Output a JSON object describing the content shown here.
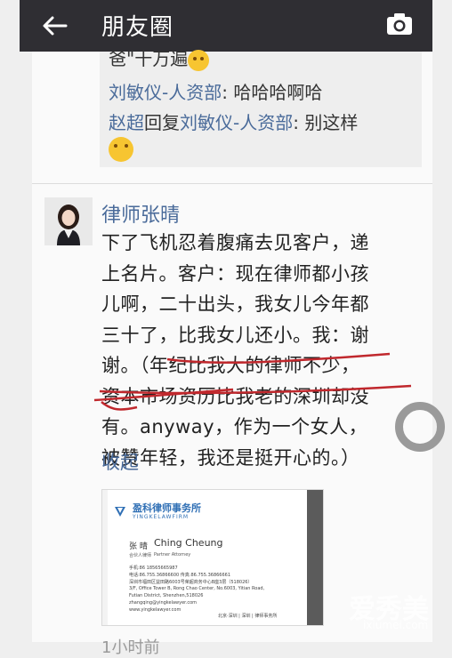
{
  "navbar": {
    "title": "朋友圈"
  },
  "comments": [
    {
      "name": "",
      "text": "爸\"十万遍"
    },
    {
      "name": "刘敏仪-人资部",
      "text": ": 哈哈哈啊哈"
    },
    {
      "name": "赵超",
      "reply_word": "回复",
      "reply_to": "刘敏仪-人资部",
      "text": ": 别这样"
    }
  ],
  "post": {
    "author": "律师张晴",
    "lines": [
      "下了飞机忍着腹痛去见客户，递",
      "上名片。客户：现在律师都小孩",
      "儿啊，二十出头，我女儿今年都",
      "三十了，比我女儿还小。我：谢",
      "谢。（年纪比我大的律师不少，",
      "资本市场资历比我老的深圳却没",
      "有。anyway，作为一个女人，",
      "被赞年轻，我还是挺开心的。）"
    ],
    "collapse": "收起",
    "time": "1小时前"
  },
  "card": {
    "firm_name": "盈科律师事务所",
    "firm_en": "YINGKELAWFIRM",
    "cn_name": "张 晴",
    "en_name": "Ching Cheung",
    "title_cn": "合伙人律师",
    "title_en": "Partner Attorney",
    "mobile": "手机:86 18565665987",
    "phone": "电话:86.755.36866600  传真:86.755.36866661",
    "address_cn": "深圳市福田区益田路6003号荣超商务中心B座3层（518026）",
    "address_en1": "3/F, Office Tower B, Rong Chao Center, No.6003, Yitian Road,",
    "address_en2": "Futian District, Shenzhen,518026",
    "email": "zhangqing@yingkelawyer.com",
    "web": "www.yingkelawyer.com",
    "footer": "北京·深圳 | 深圳 | 律师事务所"
  },
  "watermark": {
    "main": "爱秀美",
    "sub": "ixiumei.com"
  },
  "colors": {
    "navbar": "#2f2e33",
    "link": "#4a6b9a",
    "underline": "#c0282d"
  }
}
